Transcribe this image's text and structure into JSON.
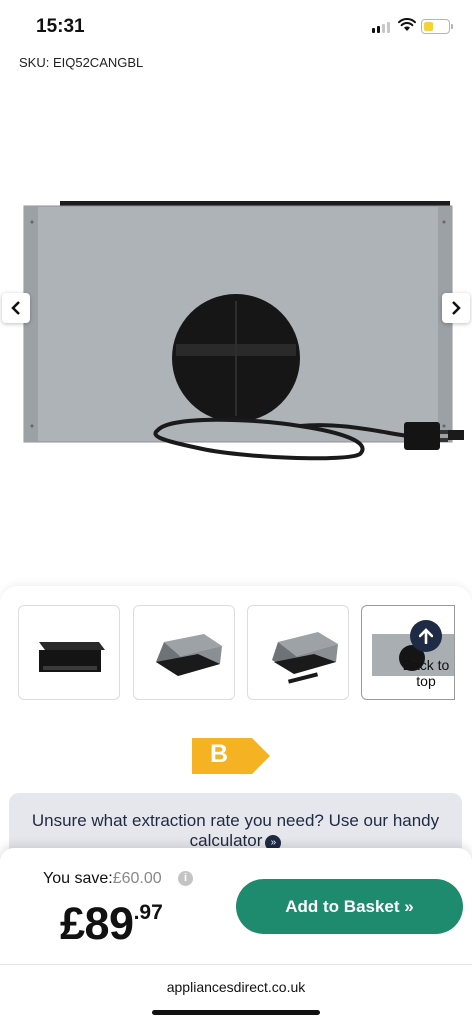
{
  "status": {
    "time": "15:31"
  },
  "product": {
    "sku": "SKU: EIQ52CANGBL"
  },
  "energy": {
    "rating": "B",
    "color": "#f5b324"
  },
  "back_to_top": {
    "label": "Back to top"
  },
  "calculator": {
    "text": "Unsure what extraction rate you need? Use our handy calculator",
    "icon": "double-chevron-right-icon"
  },
  "pricing": {
    "save_label": "You save:",
    "save_amount": "£60.00",
    "price_main": "£89",
    "price_pence": ".97",
    "add_label": "Add to Basket »"
  },
  "browser": {
    "url": "appliancesdirect.co.uk"
  },
  "colors": {
    "brand_green": "#1e8a6e",
    "navy": "#1f2a44",
    "battery": "#f4d23a"
  }
}
